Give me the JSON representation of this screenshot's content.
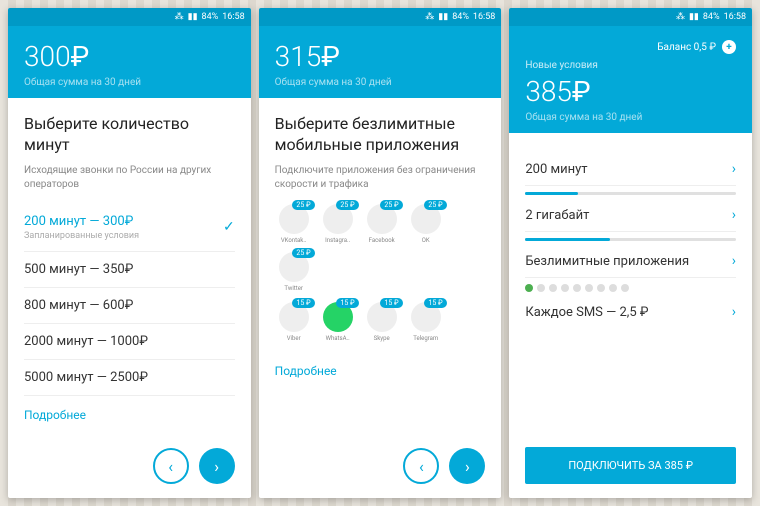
{
  "statusbar": {
    "battery": "84%",
    "time": "16:58"
  },
  "screen1": {
    "price": "300",
    "currency": "₽",
    "sub": "Общая сумма на 30 дней",
    "title": "Выберите количество минут",
    "desc": "Исходящие звонки по России на других операторов",
    "options": [
      {
        "label": "200 минут — 300₽",
        "sub": "Запланированные условия",
        "selected": true
      },
      {
        "label": "500 минут — 350₽"
      },
      {
        "label": "800 минут — 600₽"
      },
      {
        "label": "2000 минут — 1000₽"
      },
      {
        "label": "5000 минут — 2500₽"
      }
    ],
    "more": "Подробнее"
  },
  "screen2": {
    "price": "315",
    "currency": "₽",
    "sub": "Общая сумма на 30 дней",
    "title": "Выберите безлимитные мобильные приложения",
    "desc": "Подключите приложения без ограничения скорости и трафика",
    "apps_row1": [
      {
        "name": "VKontak..",
        "badge": "25 ₽"
      },
      {
        "name": "Instagra..",
        "badge": "25 ₽"
      },
      {
        "name": "Facebook",
        "badge": "25 ₽"
      },
      {
        "name": "OK",
        "badge": "25 ₽"
      },
      {
        "name": "Twitter",
        "badge": "25 ₽"
      }
    ],
    "apps_row2": [
      {
        "name": "Viber",
        "badge": "15 ₽"
      },
      {
        "name": "WhatsA..",
        "badge": "15 ₽",
        "active": true
      },
      {
        "name": "Skype",
        "badge": "15 ₽"
      },
      {
        "name": "Telegram",
        "badge": "15 ₽"
      }
    ],
    "more": "Подробнее"
  },
  "screen3": {
    "balance_label": "Баланс 0,5 ₽",
    "new_cond": "Новые условия",
    "price": "385",
    "currency": "₽",
    "sub": "Общая сумма на 30 дней",
    "rows": [
      {
        "label": "200 минут",
        "fill": 25
      },
      {
        "label": "2 гигабайт",
        "fill": 40
      },
      {
        "label": "Безлимитные приложения",
        "dots": true
      },
      {
        "label": "Каждое SMS — 2,5 ₽"
      }
    ],
    "connect": "ПОДКЛЮЧИТЬ ЗА 385 ₽"
  }
}
